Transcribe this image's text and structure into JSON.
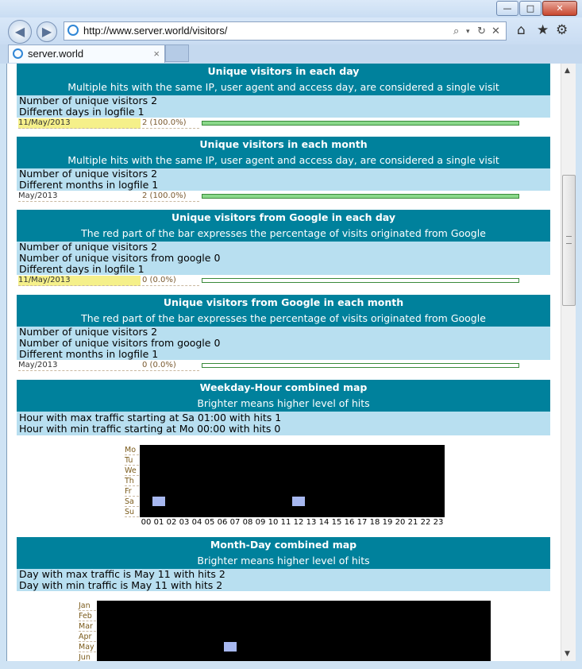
{
  "browser": {
    "window_buttons": [
      "—",
      "□",
      "✕"
    ],
    "url": "http://www.server.world/visitors/",
    "tab_title": "server.world",
    "tab_close": "×",
    "back_icon": "arrow-left-icon",
    "forward_icon": "arrow-right-icon",
    "home_icon": "home-icon",
    "favorites_icon": "star-icon",
    "tools_icon": "gear-icon"
  },
  "sections": {
    "uv_day": {
      "title": "Unique visitors in each day",
      "subtitle": "Multiple hits with the same IP, user agent and access day, are considered a single visit",
      "info": [
        "Number of unique visitors 2",
        "Different days in logfile 1"
      ],
      "row": {
        "label": "11/May/2013",
        "value": "2 (100.0%)",
        "percent": 100
      }
    },
    "uv_month": {
      "title": "Unique visitors in each month",
      "subtitle": "Multiple hits with the same IP, user agent and access day, are considered a single visit",
      "info": [
        "Number of unique visitors 2",
        "Different months in logfile 1"
      ],
      "row": {
        "label": "May/2013",
        "value": "2 (100.0%)",
        "percent": 100
      }
    },
    "google_day": {
      "title": "Unique visitors from Google in each day",
      "subtitle": "The red part of the bar expresses the percentage of visits originated from Google",
      "info": [
        "Number of unique visitors 2",
        "Number of unique visitors from google 0",
        "Different days in logfile 1"
      ],
      "row": {
        "label": "11/May/2013",
        "value": "0 (0.0%)",
        "percent": 0
      }
    },
    "google_month": {
      "title": "Unique visitors from Google in each month",
      "subtitle": "The red part of the bar expresses the percentage of visits originated from Google",
      "info": [
        "Number of unique visitors 2",
        "Number of unique visitors from google 0",
        "Different months in logfile 1"
      ],
      "row": {
        "label": "May/2013",
        "value": "0 (0.0%)",
        "percent": 0
      }
    },
    "weekday_hour": {
      "title": "Weekday-Hour combined map",
      "subtitle": "Brighter means higher level of hits",
      "info": [
        "Hour with max traffic starting at Sa 01:00 with hits 1",
        "Hour with min traffic starting at Mo 00:00 with hits 0"
      ],
      "days": [
        "Mo",
        "Tu",
        "We",
        "Th",
        "Fr",
        "Sa",
        "Su"
      ],
      "hours": [
        "00",
        "01",
        "02",
        "03",
        "04",
        "05",
        "06",
        "07",
        "08",
        "09",
        "10",
        "11",
        "12",
        "13",
        "14",
        "15",
        "16",
        "17",
        "18",
        "19",
        "20",
        "21",
        "22",
        "23"
      ],
      "hot_cells": [
        {
          "day": "Sa",
          "hour": "01"
        },
        {
          "day": "Sa",
          "hour": "12"
        }
      ]
    },
    "month_day": {
      "title": "Month-Day combined map",
      "subtitle": "Brighter means higher level of hits",
      "info": [
        "Day with max traffic is May 11 with hits 2",
        "Day with min traffic is May 11 with hits 2"
      ],
      "months": [
        "Jan",
        "Feb",
        "Mar",
        "Apr",
        "May",
        "Jun"
      ],
      "hot_cells": [
        {
          "month": "May",
          "day": 11
        }
      ]
    }
  }
}
